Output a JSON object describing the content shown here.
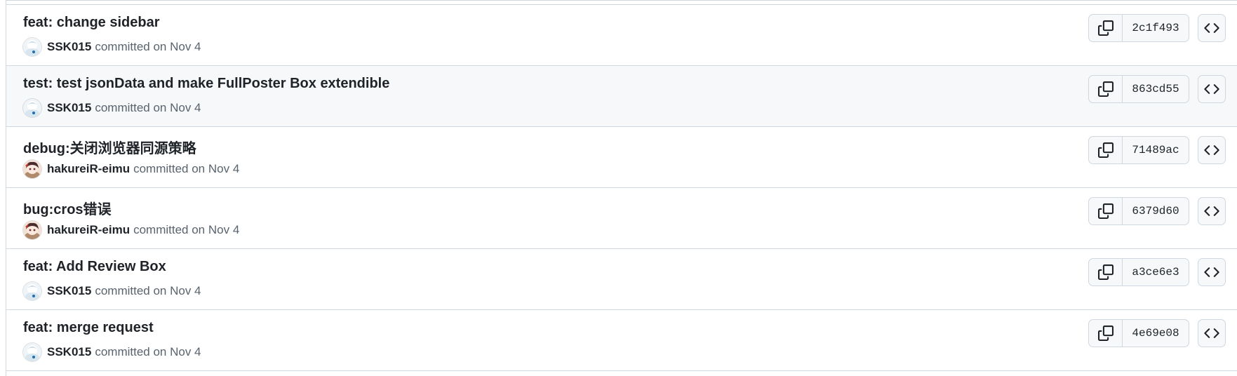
{
  "commits": [
    {
      "title": "feat: change sidebar",
      "author": "SSK015",
      "meta": "committed on Nov 4",
      "sha": "2c1f493",
      "avatar_icon": "ssk015-avatar-icon",
      "hovered": false
    },
    {
      "title": "test: test jsonData and make FullPoster Box extendible",
      "author": "SSK015",
      "meta": "committed on Nov 4",
      "sha": "863cd55",
      "avatar_icon": "ssk015-avatar-icon",
      "hovered": true
    },
    {
      "title": "debug:关闭浏览器同源策略",
      "author": "hakureiR-eimu",
      "meta": "committed on Nov 4",
      "sha": "71489ac",
      "avatar_icon": "hakureir-eimu-avatar-icon",
      "hovered": false
    },
    {
      "title": "bug:cros错误",
      "author": "hakureiR-eimu",
      "meta": "committed on Nov 4",
      "sha": "6379d60",
      "avatar_icon": "hakureir-eimu-avatar-icon",
      "hovered": false
    },
    {
      "title": "feat: Add Review Box",
      "author": "SSK015",
      "meta": "committed on Nov 4",
      "sha": "a3ce6e3",
      "avatar_icon": "ssk015-avatar-icon",
      "hovered": false
    },
    {
      "title": "feat: merge request",
      "author": "SSK015",
      "meta": "committed on Nov 4",
      "sha": "4e69e08",
      "avatar_icon": "ssk015-avatar-icon",
      "hovered": false
    }
  ],
  "icons": {
    "copy": "copy-icon",
    "browse": "code-icon"
  },
  "colors": {
    "border": "#d0d7de",
    "hover_bg": "#f6f8fa",
    "muted_text": "#59636e",
    "text": "#1f2328"
  }
}
